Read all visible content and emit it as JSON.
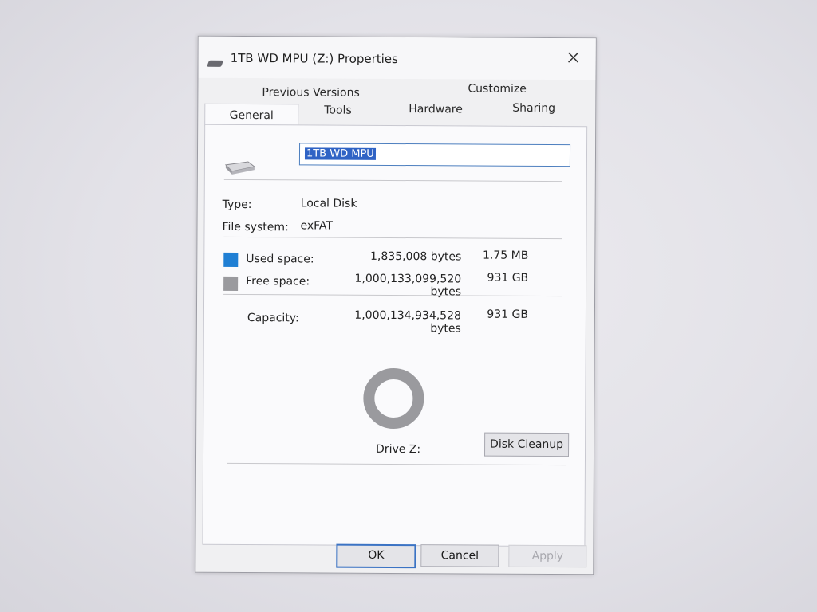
{
  "window": {
    "title": "1TB WD MPU (Z:) Properties",
    "close_icon": "close-icon"
  },
  "tabs": {
    "general": "General",
    "previous_versions": "Previous Versions",
    "customize": "Customize",
    "tools": "Tools",
    "hardware": "Hardware",
    "sharing": "Sharing"
  },
  "general": {
    "drive_icon": "drive-icon",
    "name_value": "1TB WD MPU",
    "type_label": "Type:",
    "type_value": "Local Disk",
    "fs_label": "File system:",
    "fs_value": "exFAT",
    "used_label": "Used space:",
    "used_bytes": "1,835,008 bytes",
    "used_size": "1.75 MB",
    "free_label": "Free space:",
    "free_bytes": "1,000,133,099,520 bytes",
    "free_size": "931 GB",
    "capacity_label": "Capacity:",
    "capacity_bytes": "1,000,134,934,528 bytes",
    "capacity_size": "931 GB",
    "drive_label": "Drive Z:",
    "disk_cleanup": "Disk Cleanup",
    "used_fraction": 1.8e-06,
    "colors": {
      "used": "#1f7fd4",
      "free": "#9a9a9e"
    }
  },
  "footer": {
    "ok": "OK",
    "cancel": "Cancel",
    "apply": "Apply"
  }
}
